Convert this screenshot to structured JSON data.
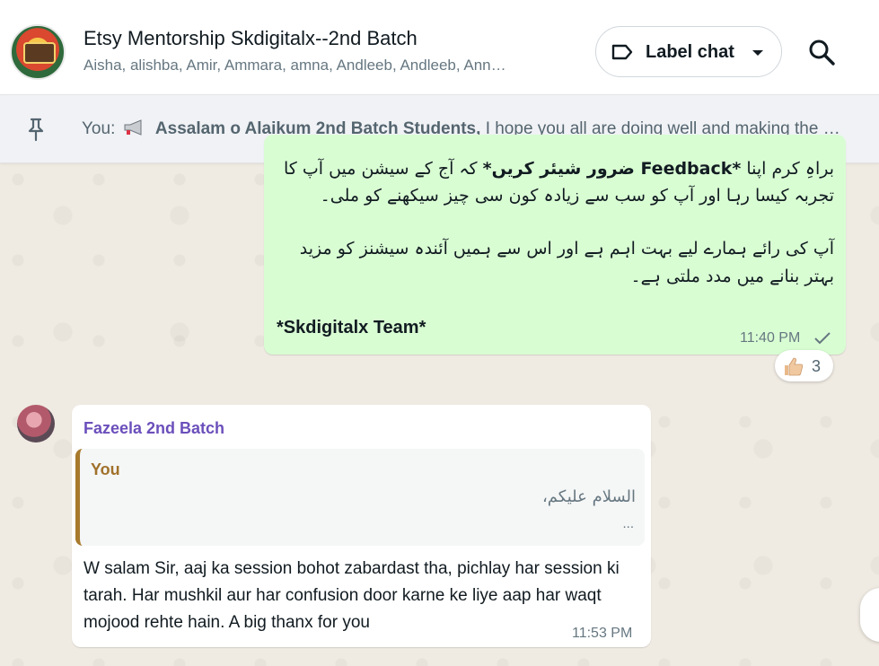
{
  "header": {
    "title": "Etsy Mentorship Skdigitalx--2nd Batch",
    "subtitle": "Aisha, alishba, Amir, Ammara, amna, Andleeb, Andleeb, Ann…",
    "label_chat": "Label chat"
  },
  "pinned": {
    "prefix": "You:",
    "bold": "Assalam o Alaikum 2nd Batch Students,",
    "rest": "I hope you all are doing well and making the …"
  },
  "outgoing": {
    "urdu_line1_pre": "براہِ کرم اپنا ",
    "urdu_line1_bold": "*Feedback ضرور شیئر کریں*",
    "urdu_line1_post": " کہ آج کے سیشن میں آپ کا",
    "urdu_line2": "تجربہ کیسا رہا اور آپ کو سب سے زیادہ کون سی چیز سیکھنے کو ملی۔",
    "urdu_line3": "آپ کی رائے ہمارے لیے بہت اہم ہے اور اس سے ہمیں آئندہ سیشنز کو مزید",
    "urdu_line4": "بہتر بنانے میں مدد ملتی ہے۔",
    "team": "*Skdigitalx Team*",
    "time": "11:40 PM",
    "reaction_count": "3"
  },
  "incoming": {
    "sender": "Fazeela 2nd Batch",
    "quote_name": "You",
    "quote_text": "السلام علیکم،",
    "quote_more": "...",
    "text": "W salam Sir, aaj ka session bohot zabardast tha, pichlay har session ki tarah. Har mushkil aur har confusion door karne ke liye aap har waqt mojood rehte hain. A big thanx for you",
    "time": "11:53 PM"
  },
  "colors": {
    "outgoing_bubble": "#d9fdd3",
    "sender_name": "#6b4fbb",
    "quote_bar": "#a87a2c"
  },
  "icons": [
    "group-avatar",
    "label-icon",
    "caret-down-icon",
    "search-icon",
    "pin-icon",
    "megaphone-icon",
    "check-icon",
    "thumbs-up-icon"
  ]
}
